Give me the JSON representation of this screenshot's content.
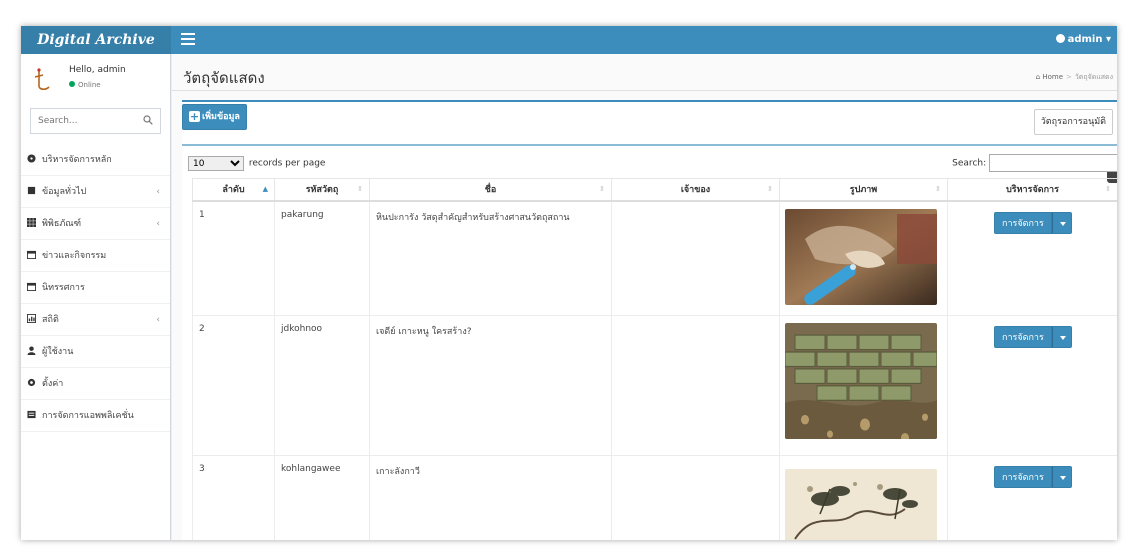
{
  "app": {
    "logo": "Digital Archive",
    "top_user": "admin"
  },
  "user_panel": {
    "greeting": "Hello, admin",
    "status": "Online"
  },
  "sidebar": {
    "search_placeholder": "Search...",
    "items": [
      {
        "label": "บริหารจัดการหลัก",
        "icon": "dashboard-icon",
        "has_children": false
      },
      {
        "label": "ข้อมูลทั่วไป",
        "icon": "book-icon",
        "has_children": true
      },
      {
        "label": "พิพิธภัณฑ์",
        "icon": "grid-icon",
        "has_children": true
      },
      {
        "label": "ข่าวและกิจกรรม",
        "icon": "calendar-icon",
        "has_children": false
      },
      {
        "label": "นิทรรศการ",
        "icon": "calendar-icon",
        "has_children": false
      },
      {
        "label": "สถิติ",
        "icon": "chart-icon",
        "has_children": true
      },
      {
        "label": "ผู้ใช้งาน",
        "icon": "user-icon",
        "has_children": false
      },
      {
        "label": "ตั้งค่า",
        "icon": "gear-icon",
        "has_children": false
      },
      {
        "label": "การจัดการแอพพลิเคชั่น",
        "icon": "app-icon",
        "has_children": false
      }
    ]
  },
  "page": {
    "title": "วัตถุจัดแสดง",
    "breadcrumb_home": "Home",
    "breadcrumb_current": "วัตถุจัดแสดง"
  },
  "toolbar": {
    "add_label": "เพิ่มข้อมูล",
    "approve_label": "วัตถุรอการอนุมัติ"
  },
  "datatable": {
    "page_length": "10",
    "length_suffix": "records per page",
    "search_label": "Search:",
    "columns": [
      "ลำดับ",
      "รหัสวัตถุ",
      "ชื่อ",
      "เจ้าของ",
      "รูปภาพ",
      "บริหารจัดการ"
    ],
    "rows": [
      {
        "no": "1",
        "code": "pakarung",
        "name": "หินปะการัง วัสดุสำคัญสำหรับสร้างศาสนวัตถุสถาน",
        "owner": "",
        "image": "coral-stone-photo",
        "action": "การจัดการ"
      },
      {
        "no": "2",
        "code": "jdkohnoo",
        "name": "เจดีย์ เกาะหนู ใครสร้าง?",
        "owner": "",
        "image": "brick-ruin-photo",
        "action": "การจัดการ"
      },
      {
        "no": "3",
        "code": "kohlangawee",
        "name": "เกาะลังกาวี",
        "owner": "",
        "image": "ink-painting-photo",
        "action": "การจัดการ"
      }
    ]
  },
  "colors": {
    "primary": "#3c8dbc",
    "logo_bg": "#367fa9",
    "online": "#00a65a"
  }
}
